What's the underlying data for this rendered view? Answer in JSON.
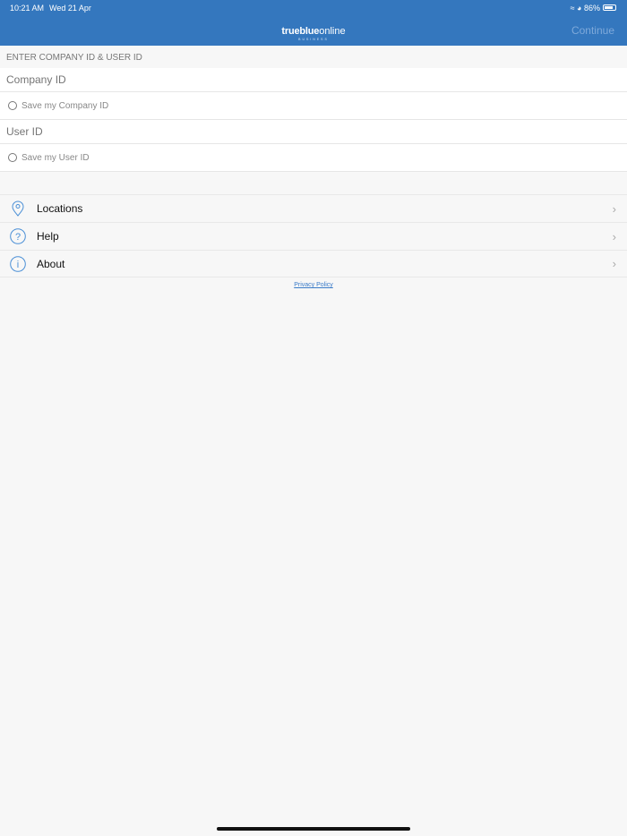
{
  "status_bar": {
    "time": "10:21 AM",
    "date": "Wed 21 Apr",
    "battery": "86%"
  },
  "header": {
    "logo_brand": "trueblue",
    "logo_online": "online",
    "logo_sub": "BUSINESS",
    "continue_label": "Continue"
  },
  "form": {
    "section_title": "ENTER COMPANY ID & USER ID",
    "company_placeholder": "Company ID",
    "save_company": "Save my Company ID",
    "user_placeholder": "User ID",
    "save_user": "Save my User ID"
  },
  "menu": [
    {
      "label": "Locations",
      "icon": "location-pin-icon"
    },
    {
      "label": "Help",
      "icon": "question-icon"
    },
    {
      "label": "About",
      "icon": "info-icon"
    }
  ],
  "privacy": "Privacy Policy",
  "colors": {
    "brand": "#3477be",
    "accent": "#4a8fd6"
  }
}
